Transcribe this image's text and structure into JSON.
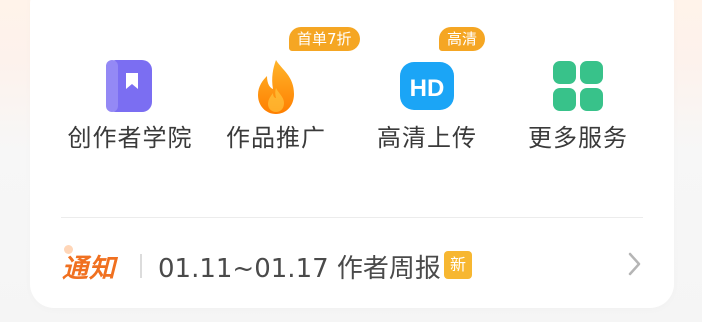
{
  "services": [
    {
      "label": "创作者学院",
      "icon": "book-bookmark-icon",
      "color": "#7a6cf0"
    },
    {
      "label": "作品推广",
      "icon": "flame-icon",
      "color": "#ff9a1a",
      "badge": "首单7折"
    },
    {
      "label": "高清上传",
      "icon": "hd-icon",
      "color": "#1aa0f5",
      "badge": "高清"
    },
    {
      "label": "更多服务",
      "icon": "grid-icon",
      "color": "#3cc48a"
    }
  ],
  "notice": {
    "tag": "通知",
    "text": "01.11~01.17 作者周报",
    "new_badge": "新"
  },
  "colors": {
    "accent": "#f07020",
    "badge": "#f5a623",
    "new_badge": "#f7b731"
  }
}
